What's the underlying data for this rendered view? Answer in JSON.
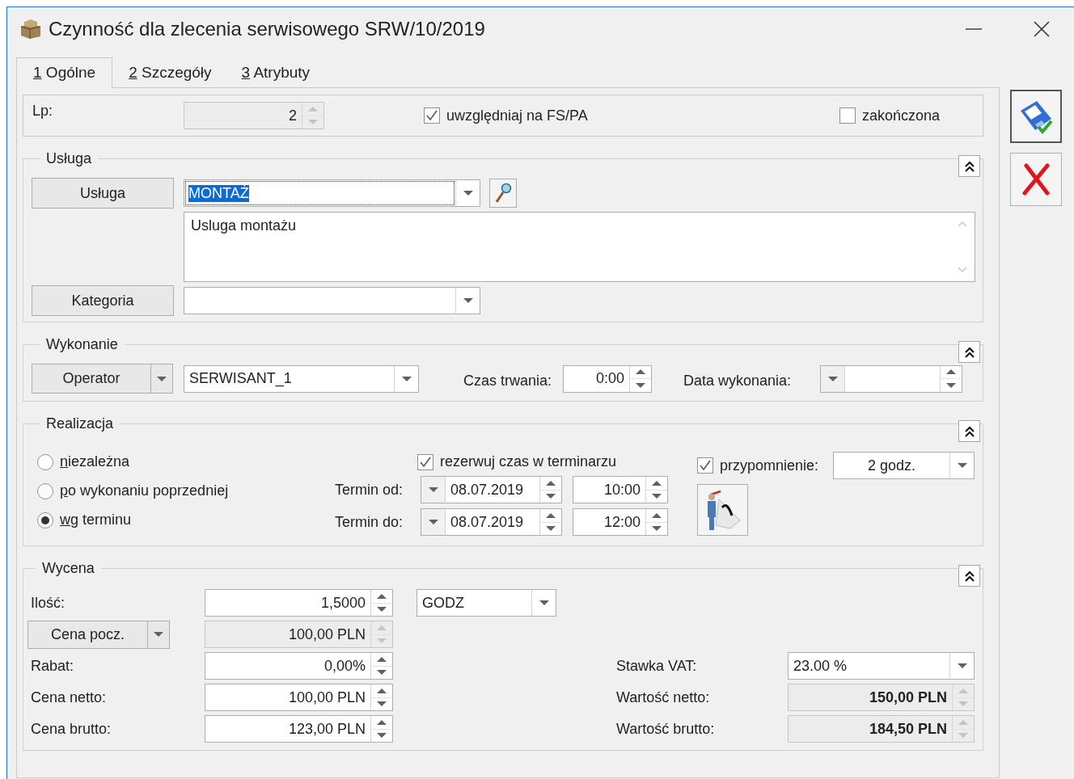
{
  "window": {
    "title": "Czynność dla zlecenia serwisowego SRW/10/2019"
  },
  "tabs": [
    {
      "label": "1 Ogólne",
      "mnemonic": true,
      "selected": true
    },
    {
      "label": "2 Szczegóły",
      "mnemonic": true,
      "selected": false
    },
    {
      "label": "3 Atrybuty",
      "mnemonic": true,
      "selected": false
    }
  ],
  "top": {
    "lp": {
      "label": "Lp:",
      "value": "2",
      "disabled": true
    },
    "checkboxes": [
      {
        "label": "uwzględniaj na FS/PA",
        "checked": true
      },
      {
        "label": "zakończona",
        "checked": false
      }
    ]
  },
  "usluga": {
    "title": "Usługa",
    "expanded": true,
    "service_button": "Usługa",
    "service": {
      "value": "MONTAŻ",
      "selected": true
    },
    "description": "Usluga montażu",
    "category_button": "Kategoria"
  },
  "wykonanie": {
    "title": "Wykonanie",
    "expanded": true,
    "operator_button": "Operator",
    "operator": "SERWISANT_1",
    "duration_label": "Czas trwania:",
    "duration": "0:00",
    "date_label": "Data wykonania:"
  },
  "realizacja": {
    "title": "Realizacja",
    "expanded": true,
    "modes": [
      {
        "label": "niezależna",
        "mnemonic": true,
        "selected": false
      },
      {
        "label": "po wykonaniu poprzedniej",
        "mnemonic": true,
        "selected": false
      },
      {
        "label": "wg terminu",
        "mnemonic": true,
        "selected": true
      }
    ],
    "reserve": {
      "label": "rezerwuj czas w terminarzu",
      "checked": true
    },
    "terms": [
      {
        "label": "Termin od:",
        "date": "08.07.2019",
        "time": "10:00"
      },
      {
        "label": "Termin do:",
        "date": "08.07.2019",
        "time": "12:00"
      }
    ],
    "reminder": {
      "label": "przypomnienie:",
      "checked": true,
      "value": "2 godz."
    }
  },
  "wycena": {
    "title": "Wycena",
    "expanded": true,
    "unit": "GODZ",
    "left": [
      {
        "kind": "label",
        "label": "Ilość:",
        "value": "1,5000",
        "disabled": false
      },
      {
        "kind": "dropdown",
        "label": "Cena pocz.",
        "value": "100,00 PLN",
        "disabled": true
      },
      {
        "kind": "label",
        "label": "Rabat:",
        "value": "0,00%",
        "disabled": false
      },
      {
        "kind": "label",
        "label": "Cena netto:",
        "value": "100,00 PLN",
        "disabled": false
      },
      {
        "kind": "label",
        "label": "Cena brutto:",
        "value": "123,00 PLN",
        "disabled": false
      }
    ],
    "right": [
      {
        "kind": "combo",
        "label": "Stawka VAT:",
        "value": "23.00 %",
        "disabled": false,
        "bold": false
      },
      {
        "kind": "spin",
        "label": "Wartość netto:",
        "value": "150,00 PLN",
        "disabled": true,
        "bold": true
      },
      {
        "kind": "spin",
        "label": "Wartość brutto:",
        "value": "184,50 PLN",
        "disabled": true,
        "bold": true
      }
    ]
  }
}
